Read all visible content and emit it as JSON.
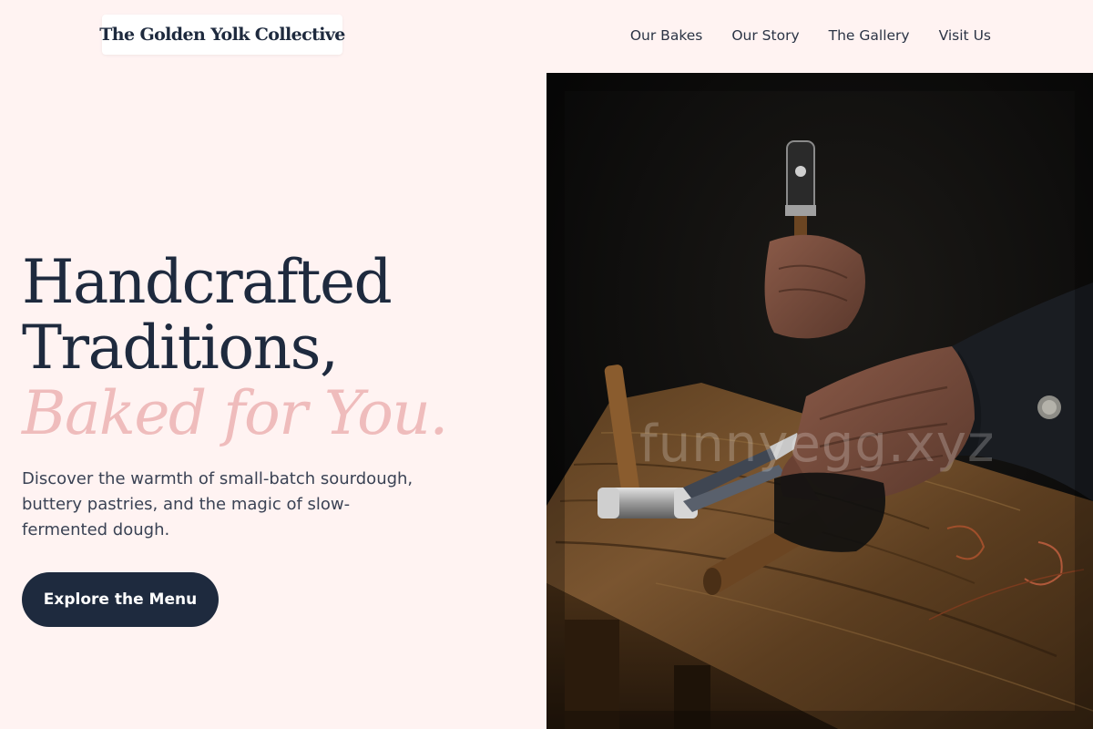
{
  "header": {
    "logo": "The Golden Yolk Collective",
    "nav": [
      "Our Bakes",
      "Our Story",
      "The Gallery",
      "Visit Us"
    ]
  },
  "hero": {
    "title_line1": "Handcrafted",
    "title_line2": "Traditions,",
    "title_accent": "Baked for You.",
    "description": "Discover the warmth of small-batch sourdough, buttery pastries, and the magic of slow-fermented dough.",
    "cta_label": "Explore the Menu",
    "image_watermark": "funnyegg.xyz"
  },
  "colors": {
    "background": "#fff3f2",
    "navy": "#1e2a3e",
    "accent_pink": "#efbcbc"
  }
}
